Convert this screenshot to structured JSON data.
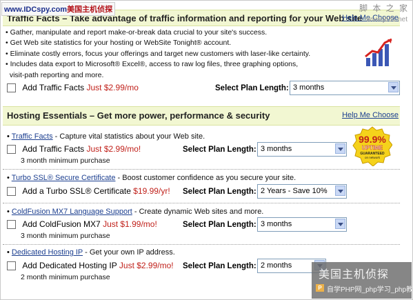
{
  "watermarks": {
    "top_left": "www.IDCspy.com",
    "top_left_cn": "美国主机侦探",
    "top_right": "脚 本 之 家",
    "top_right_url": "www.jb51.net",
    "bottom_right_title": "美国主机侦探",
    "bottom_right_site": "自学PHP网_php学习_php教"
  },
  "traffic": {
    "title": "Traffic Facts – Take advantage of traffic information and reporting for your Web site",
    "help": "Help Me Choose",
    "bullets": [
      "• Gather, manipulate and report make-or-break data crucial to your site's success.",
      "• Get Web site statistics for your hosting or WebSite Tonight® account.",
      "• Eliminate costly errors, focus your offerings and target new customers with laser-like certainty.",
      "• Includes data export to Microsoft® Excel®, access to raw log files, three graphing options,",
      "  visit-path reporting and more."
    ],
    "add_label": "Add Traffic Facts",
    "price": "Just $2.99/mo",
    "plan_label": "Select Plan Length:",
    "plan_value": "3 months"
  },
  "hosting": {
    "title": "Hosting Essentials – Get more power, performance & security",
    "help": "Help Me Choose",
    "items": [
      {
        "link": "Traffic Facts",
        "desc": " - Capture vital statistics about your Web site.",
        "add_label": "Add Traffic Facts",
        "price": "Just $2.99/mo!",
        "plan_label": "Select Plan Length:",
        "plan_value": "3 months",
        "minimum": "3 month minimum purchase"
      },
      {
        "link": "Turbo SSL® Secure Certificate",
        "desc": " - Boost customer confidence as you secure your site.",
        "add_label": "Add a Turbo SSL® Certificate",
        "price": "$19.99/yr!",
        "plan_label": "Select Plan Length:",
        "plan_value": "2 Years - Save 10%",
        "minimum": ""
      },
      {
        "link": "ColdFusion MX7 Language Support",
        "desc": " - Create dynamic Web sites and more.",
        "add_label": "Add ColdFusion MX7",
        "price": "Just $1.99/mo!",
        "plan_label": "Select Plan Length:",
        "plan_value": "3 months",
        "minimum": "3 month minimum purchase"
      },
      {
        "link": "Dedicated Hosting IP",
        "desc": " - Get your own IP address.",
        "add_label": "Add Dedicated Hosting IP",
        "price": "Just $2.99/mo!",
        "plan_label": "Select Plan Length:",
        "plan_value": "2 months",
        "minimum": "2 month minimum purchase"
      }
    ]
  },
  "badge": {
    "percent": "99.9%",
    "uptime": "UPTIME",
    "guaranteed": "GUARANTEED",
    "network": "on network"
  },
  "colors": {
    "header_bg": "#f2f7d2",
    "link": "#1b3e8f",
    "price": "#c0201a"
  },
  "icons": [
    "bar-chart-icon",
    "uptime-badge-icon",
    "dropdown-arrow-icon",
    "checkbox"
  ]
}
